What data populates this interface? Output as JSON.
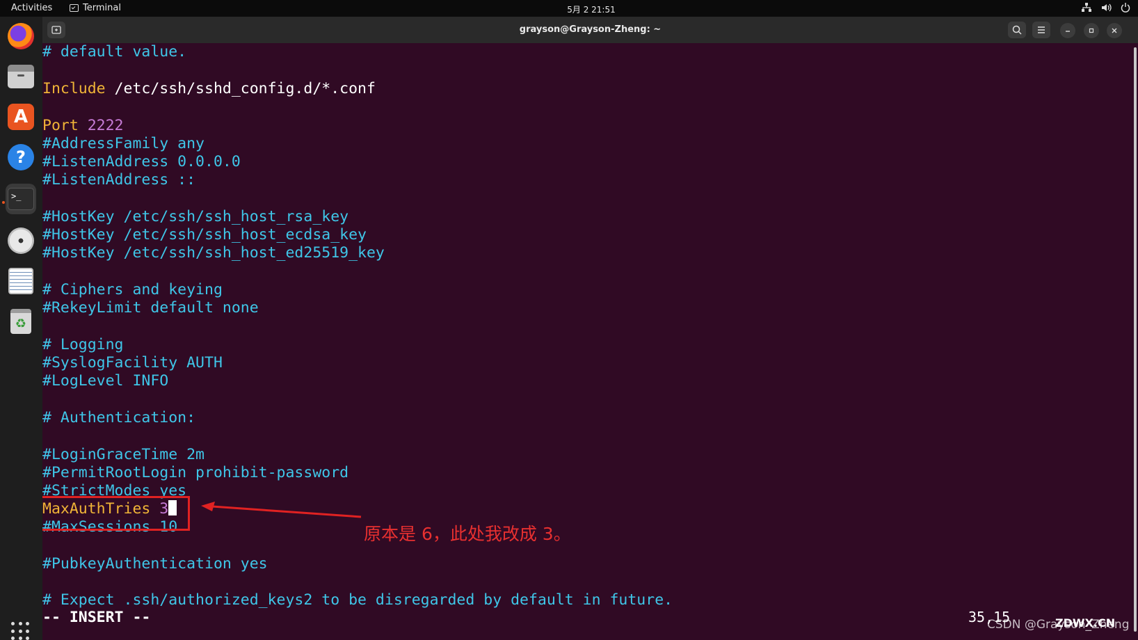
{
  "topbar": {
    "activities": "Activities",
    "app_name": "Terminal",
    "clock": "5月 2 21:51"
  },
  "window": {
    "title": "grayson@Grayson-Zheng: ~"
  },
  "editor": {
    "lines": [
      {
        "text": "# default value."
      },
      {
        "kw": "Include",
        "rest": " /etc/ssh/sshd_config.d/*.conf"
      },
      {
        "kw": "Port",
        "num": " 2222"
      },
      {
        "text": "#AddressFamily any"
      },
      {
        "text": "#ListenAddress 0.0.0.0"
      },
      {
        "text": "#ListenAddress ::"
      },
      {
        "text": "#HostKey /etc/ssh/ssh_host_rsa_key"
      },
      {
        "text": "#HostKey /etc/ssh/ssh_host_ecdsa_key"
      },
      {
        "text": "#HostKey /etc/ssh/ssh_host_ed25519_key"
      },
      {
        "text": "# Ciphers and keying"
      },
      {
        "text": "#RekeyLimit default none"
      },
      {
        "text": "# Logging"
      },
      {
        "text": "#SyslogFacility AUTH"
      },
      {
        "text": "#LogLevel INFO"
      },
      {
        "text": "# Authentication:"
      },
      {
        "text": "#LoginGraceTime 2m"
      },
      {
        "text": "#PermitRootLogin prohibit-password"
      },
      {
        "text": "#StrictModes yes"
      },
      {
        "kw": "MaxAuthTries",
        "num": " 3"
      },
      {
        "text": "#MaxSessions 10"
      },
      {
        "text": "#PubkeyAuthentication yes"
      },
      {
        "text": "# Expect .ssh/authorized_keys2 to be disregarded by default in future."
      }
    ],
    "mode": "-- INSERT --",
    "cursor_pos": "35,15"
  },
  "annotation": {
    "note": "原本是 6，此处我改成 3。",
    "color": "#e02222"
  },
  "watermark": {
    "csdn": "CSDN @Grayson_Zheng",
    "zdwx": "ZDWX.CN"
  },
  "colors": {
    "terminal_bg": "#300a24",
    "comment": "#3fc6e8",
    "keyword": "#f0b437",
    "number": "#c67bd6"
  }
}
